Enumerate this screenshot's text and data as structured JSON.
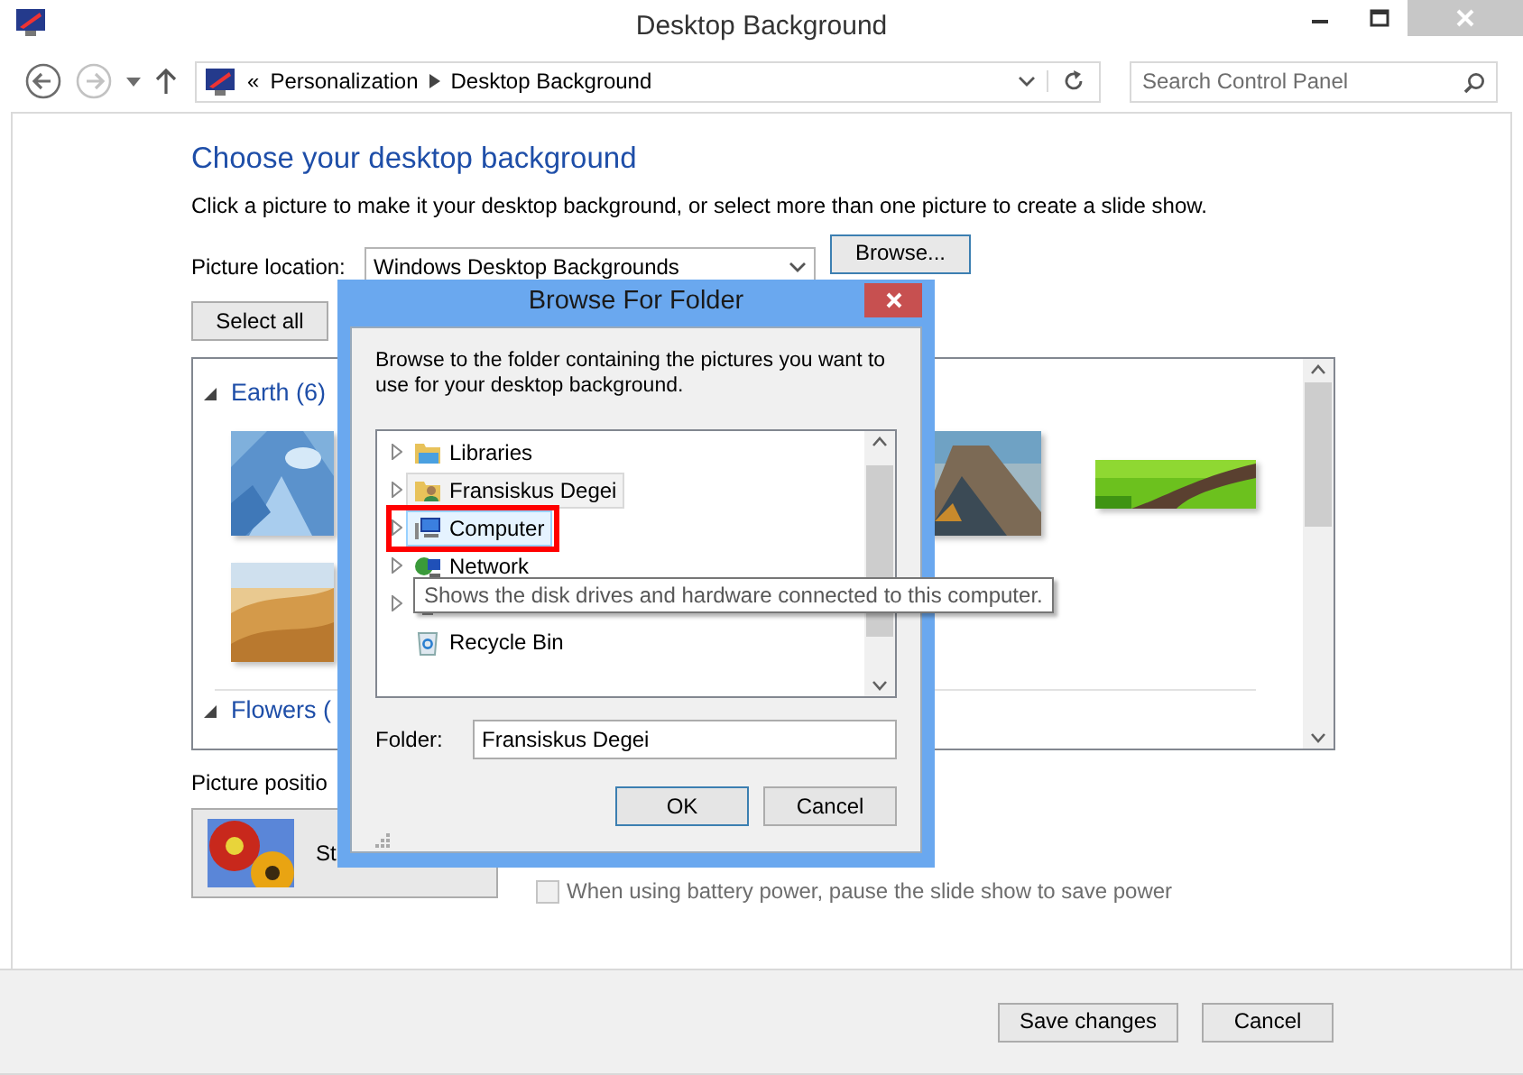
{
  "window": {
    "title": "Desktop Background"
  },
  "navigation": {
    "back_disabled": false,
    "forward_disabled": true,
    "overflow": "«",
    "breadcrumb": [
      "Personalization",
      "Desktop Background"
    ],
    "search": {
      "placeholder": "Search Control Panel"
    }
  },
  "content": {
    "heading": "Choose your desktop background",
    "description": "Click a picture to make it your desktop background, or select more than one picture to create a slide show.",
    "picture_location": {
      "label": "Picture location:",
      "value": "Windows Desktop Backgrounds",
      "button": "Browse..."
    },
    "select_all": "Select all",
    "groups": [
      {
        "label": "Earth (6)",
        "expanded": true
      },
      {
        "label": "Flowers (",
        "expanded": true
      }
    ],
    "picture_position": {
      "label": "Picture positio",
      "value": "St"
    },
    "battery_option": {
      "label": "When using battery power, pause the slide show to save power",
      "checked": false,
      "disabled": true
    }
  },
  "footer": {
    "buttons": [
      "Save changes",
      "Cancel"
    ]
  },
  "dialog": {
    "title": "Browse For Folder",
    "instructions": "Browse to the folder containing the pictures you want to use for your desktop background.",
    "tree": [
      {
        "label": "Libraries",
        "expandable": true,
        "selected": false,
        "hovered": false,
        "annotated": false
      },
      {
        "label": "Fransiskus Degei",
        "expandable": true,
        "selected": true,
        "hovered": false,
        "annotated": false
      },
      {
        "label": "Computer",
        "expandable": true,
        "selected": false,
        "hovered": true,
        "annotated": true
      },
      {
        "label": "Network",
        "expandable": true,
        "selected": false,
        "hovered": false,
        "annotated": false
      },
      {
        "expandable": true,
        "selected": false,
        "hovered": false,
        "annotated": false
      },
      {
        "label": "Recycle Bin",
        "expandable": false,
        "selected": false,
        "hovered": false,
        "annotated": false
      }
    ],
    "folder": {
      "label": "Folder:",
      "value": "Fransiskus Degei"
    },
    "buttons": [
      {
        "label": "OK",
        "default": true
      },
      {
        "label": "Cancel",
        "default": false
      }
    ],
    "tooltip": "Shows the disk drives and hardware connected to this computer."
  }
}
